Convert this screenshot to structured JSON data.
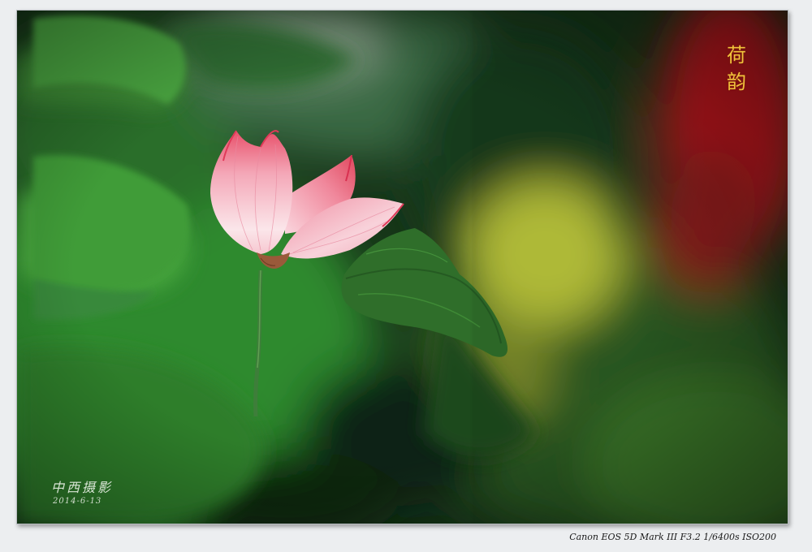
{
  "photo": {
    "subject": "lotus-bud",
    "colors": {
      "background": "#eceef0",
      "leaf_dark": "#0f2a12",
      "leaf_mid": "#2f7a2a",
      "leaf_light": "#5fb24a",
      "petal_pink": "#f07a90",
      "petal_white": "#fbe6ea",
      "bokeh_red": "#c8202a",
      "bokeh_yellow": "#c8d040",
      "title_gold": "#f0c23c"
    }
  },
  "overlay": {
    "title_line1": "荷",
    "title_line2": "韵",
    "signature": "中西摄影",
    "date": "2014-6-13"
  },
  "caption": {
    "exif": "Canon EOS 5D Mark III F3.2 1/6400s ISO200"
  }
}
